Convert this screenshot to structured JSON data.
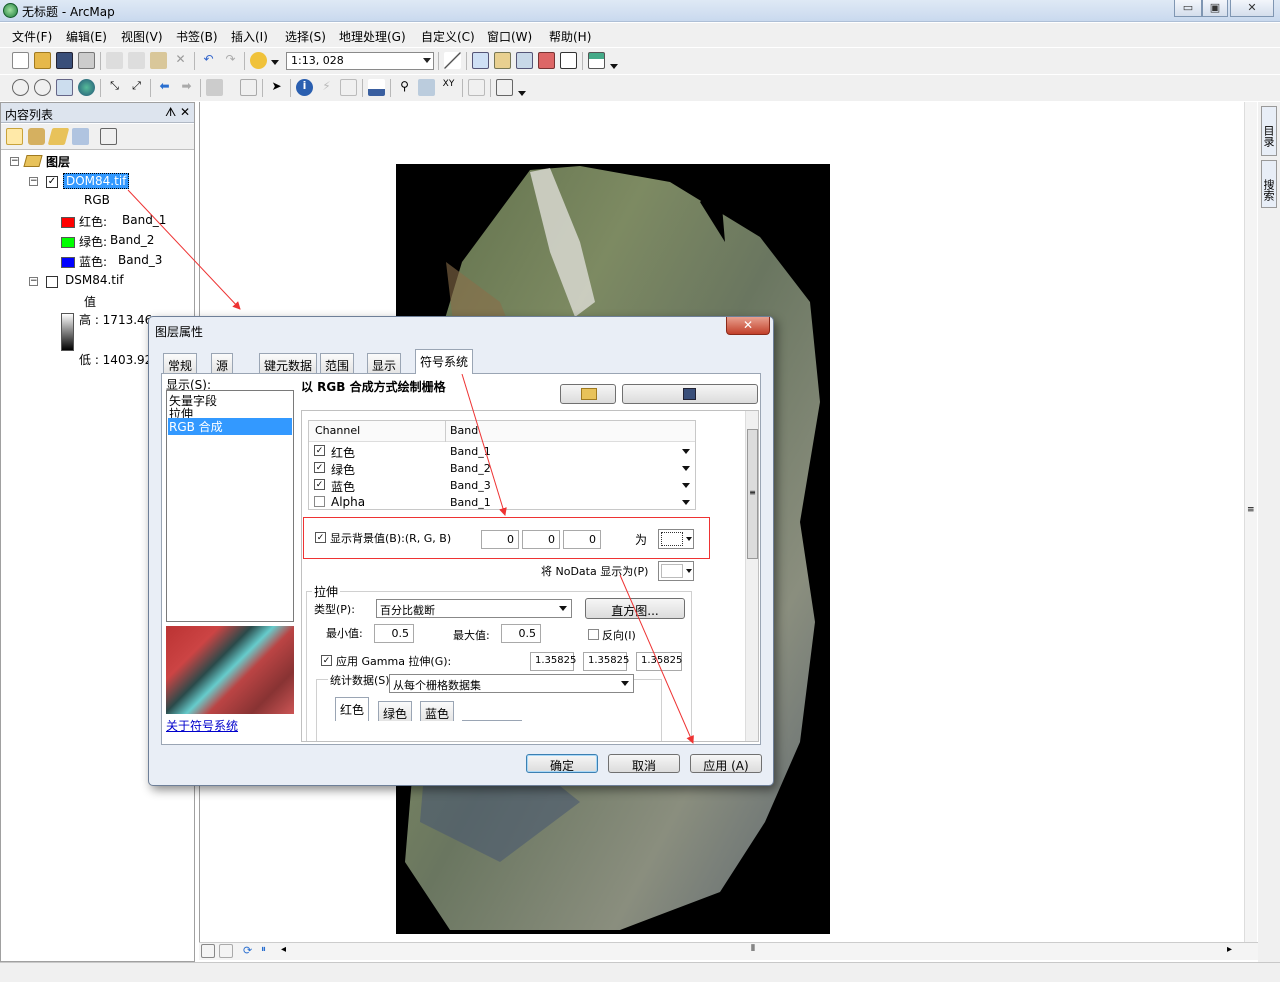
{
  "window": {
    "title": "无标题 - ArcMap",
    "min": "▭",
    "max": "▣",
    "close": "✕"
  },
  "menu": [
    "文件(F)",
    "编辑(E)",
    "视图(V)",
    "书签(B)",
    "插入(I)",
    "选择(S)",
    "地理处理(G)",
    "自定义(C)",
    "窗口(W)",
    "帮助(H)"
  ],
  "toolbar": {
    "scale": "1:13, 028"
  },
  "toc": {
    "title": "内容列表",
    "pin": "ᗑ",
    "close": "✕",
    "layers_root": "图层",
    "layer1": {
      "name": "DOM84.tif",
      "type": "RGB",
      "bands": [
        {
          "label": "红色:",
          "band": "Band_1",
          "color": "#ff0000"
        },
        {
          "label": "绿色:",
          "band": "Band_2",
          "color": "#00ff00"
        },
        {
          "label": "蓝色:",
          "band": "Band_3",
          "color": "#0000ff"
        }
      ]
    },
    "layer2": {
      "name": "DSM84.tif",
      "value_label": "值",
      "high": "高 : 1713.46",
      "low": "低 : 1403.92"
    }
  },
  "rightbar": {
    "catalog": "目录",
    "search": "搜索"
  },
  "dialog": {
    "title": "图层属性",
    "tabs": [
      "常规",
      "源",
      "键元数据",
      "范围",
      "显示",
      "符号系统"
    ],
    "show_label": "显示(S):",
    "show_items": [
      "矢量字段",
      "拉伸",
      "RGB 合成"
    ],
    "about_link": "关于符号系统",
    "heading": "以 RGB 合成方式绘制栅格",
    "table_headers": {
      "channel": "Channel",
      "band": "Band"
    },
    "channels": [
      {
        "name": "红色",
        "band": "Band_1",
        "checked": true
      },
      {
        "name": "绿色",
        "band": "Band_2",
        "checked": true
      },
      {
        "name": "蓝色",
        "band": "Band_3",
        "checked": true
      },
      {
        "name": "Alpha",
        "band": "Band_1",
        "checked": false
      }
    ],
    "bg_label": "显示背景值(B):(R, G, B)",
    "bg_values": [
      "0",
      "0",
      "0"
    ],
    "bg_as": "为",
    "nodata_label": "将 NoData 显示为(P)",
    "stretch": {
      "group": "拉伸",
      "type_label": "类型(P):",
      "type_value": "百分比截断",
      "histogram_btn": "直方图...",
      "min_label": "最小值:",
      "min_value": "0.5",
      "max_label": "最大值:",
      "max_value": "0.5",
      "invert_label": "反向(I)",
      "gamma_label": "应用 Gamma 拉伸(G):",
      "gamma_values": [
        "1.35825",
        "1.35825",
        "1.35825"
      ],
      "stats_label": "统计数据(S)",
      "stats_value": "从每个栅格数据集",
      "stats_tabs": [
        "红色",
        "绿色",
        "蓝色"
      ]
    },
    "buttons": {
      "ok": "确定",
      "cancel": "取消",
      "apply": "应用 (A)"
    },
    "accent": "#3399ff",
    "highlight": "#e33333"
  }
}
